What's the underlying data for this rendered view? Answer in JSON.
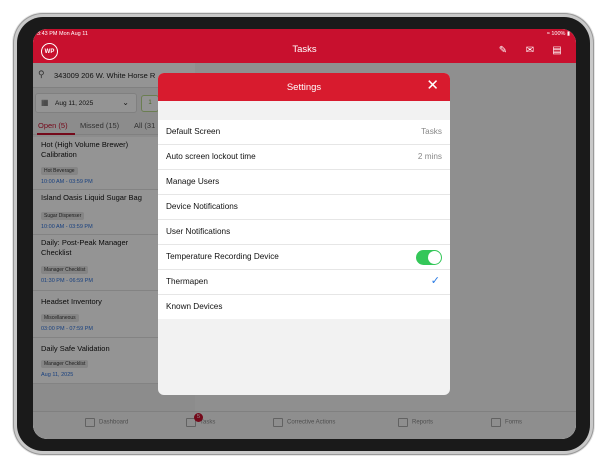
{
  "status_bar": {
    "time": "3:43 PM  Mon Aug 11",
    "battery": "100%"
  },
  "header": {
    "logo": "WP",
    "title": "Tasks",
    "icons": [
      "edit-icon",
      "chat-icon",
      "profile-card-icon"
    ]
  },
  "left_panel": {
    "address": "343009 206 W. White Horse R",
    "date": "Aug 11, 2025",
    "badge": "1",
    "tabs": [
      {
        "label": "Open (5)"
      },
      {
        "label": "Missed (15)"
      },
      {
        "label": "All (31"
      }
    ],
    "tasks": [
      {
        "name": "Hot (High Volume Brewer) Calibration",
        "category": "Hot Beverage",
        "time": "10:00 AM - 03:59 PM"
      },
      {
        "name": "Island Oasis Liquid Sugar Bag",
        "category": "Sugar Dispenser",
        "time": "10:00 AM - 03:59 PM"
      },
      {
        "name": "Daily: Post-Peak Manager Checklist",
        "category": "Manager Checklist",
        "time": "01:30 PM - 06:59 PM"
      },
      {
        "name": "Headset Inventory",
        "category": "Miscellaneous",
        "time": "03:00 PM - 07:59 PM"
      },
      {
        "name": "Daily Safe Validation",
        "category": "Manager Checklist",
        "time": "Aug 11, 2025"
      }
    ]
  },
  "tab_bar": {
    "items": [
      {
        "label": "Dashboard"
      },
      {
        "label": "Tasks",
        "badge": "5"
      },
      {
        "label": "Corrective Actions"
      },
      {
        "label": "Reports"
      },
      {
        "label": "Forms"
      }
    ]
  },
  "settings_modal": {
    "title": "Settings",
    "rows": [
      {
        "label": "Default Screen",
        "value": "Tasks"
      },
      {
        "label": "Auto screen lockout time",
        "value": "2 mins"
      },
      {
        "label": "Manage Users"
      },
      {
        "label": "Device Notifications"
      },
      {
        "label": "User Notifications"
      },
      {
        "label": "Temperature Recording Device",
        "toggle_on": true
      },
      {
        "label": "Thermapen",
        "checked": true
      },
      {
        "label": "Known Devices"
      }
    ]
  },
  "colors": {
    "brand_red": "#c8102e",
    "modal_red": "#d81b2e",
    "toggle_green": "#34c759",
    "check_blue": "#2a7be4",
    "time_blue": "#2a6fdb"
  }
}
